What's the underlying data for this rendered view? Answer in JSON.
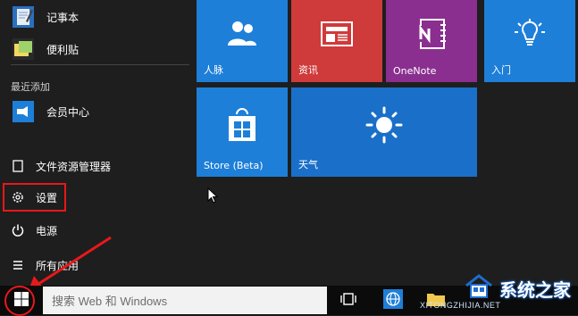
{
  "start_menu": {
    "apps": [
      {
        "label": "记事本"
      },
      {
        "label": "便利贴"
      }
    ],
    "recent_section": "最近添加",
    "recent_apps": [
      {
        "label": "会员中心"
      }
    ],
    "system_items": [
      {
        "label": "文件资源管理器"
      },
      {
        "label": "设置"
      },
      {
        "label": "电源"
      },
      {
        "label": "所有应用"
      }
    ]
  },
  "tiles": [
    {
      "label": "人脉",
      "color": "#1e7fd8"
    },
    {
      "label": "资讯",
      "color": "#cf3a3a"
    },
    {
      "label": "OneNote",
      "color": "#8a2f8f"
    },
    {
      "label": "入门",
      "color": "#1e7fd8"
    },
    {
      "label": "Store (Beta)",
      "color": "#1e7fd8"
    },
    {
      "label": "天气",
      "color": "#1a6fc9"
    }
  ],
  "taskbar": {
    "search_placeholder": "搜索 Web 和 Windows"
  },
  "watermark": {
    "brand": "系统之家",
    "url": "XITONGZHIJIA.NET"
  },
  "colors": {
    "accent": "#1e7fd8",
    "highlight": "#e8181a",
    "background": "#1f1f1f"
  }
}
